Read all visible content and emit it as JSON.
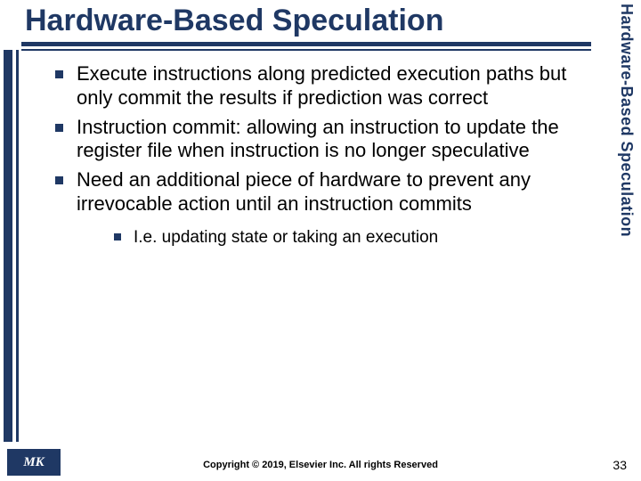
{
  "title": "Hardware-Based Speculation",
  "side_label": "Hardware-Based Speculation",
  "bullets": [
    "Execute instructions along predicted execution paths but only commit the results if prediction was correct",
    "Instruction commit:  allowing an instruction to update the register file when instruction is no longer speculative",
    "Need an additional piece of hardware to prevent any irrevocable action until an instruction commits"
  ],
  "sub_bullet": "I.e. updating state or taking an execution",
  "logo": "MK",
  "copyright": "Copyright © 2019, Elsevier Inc. All rights Reserved",
  "page_number": "33"
}
